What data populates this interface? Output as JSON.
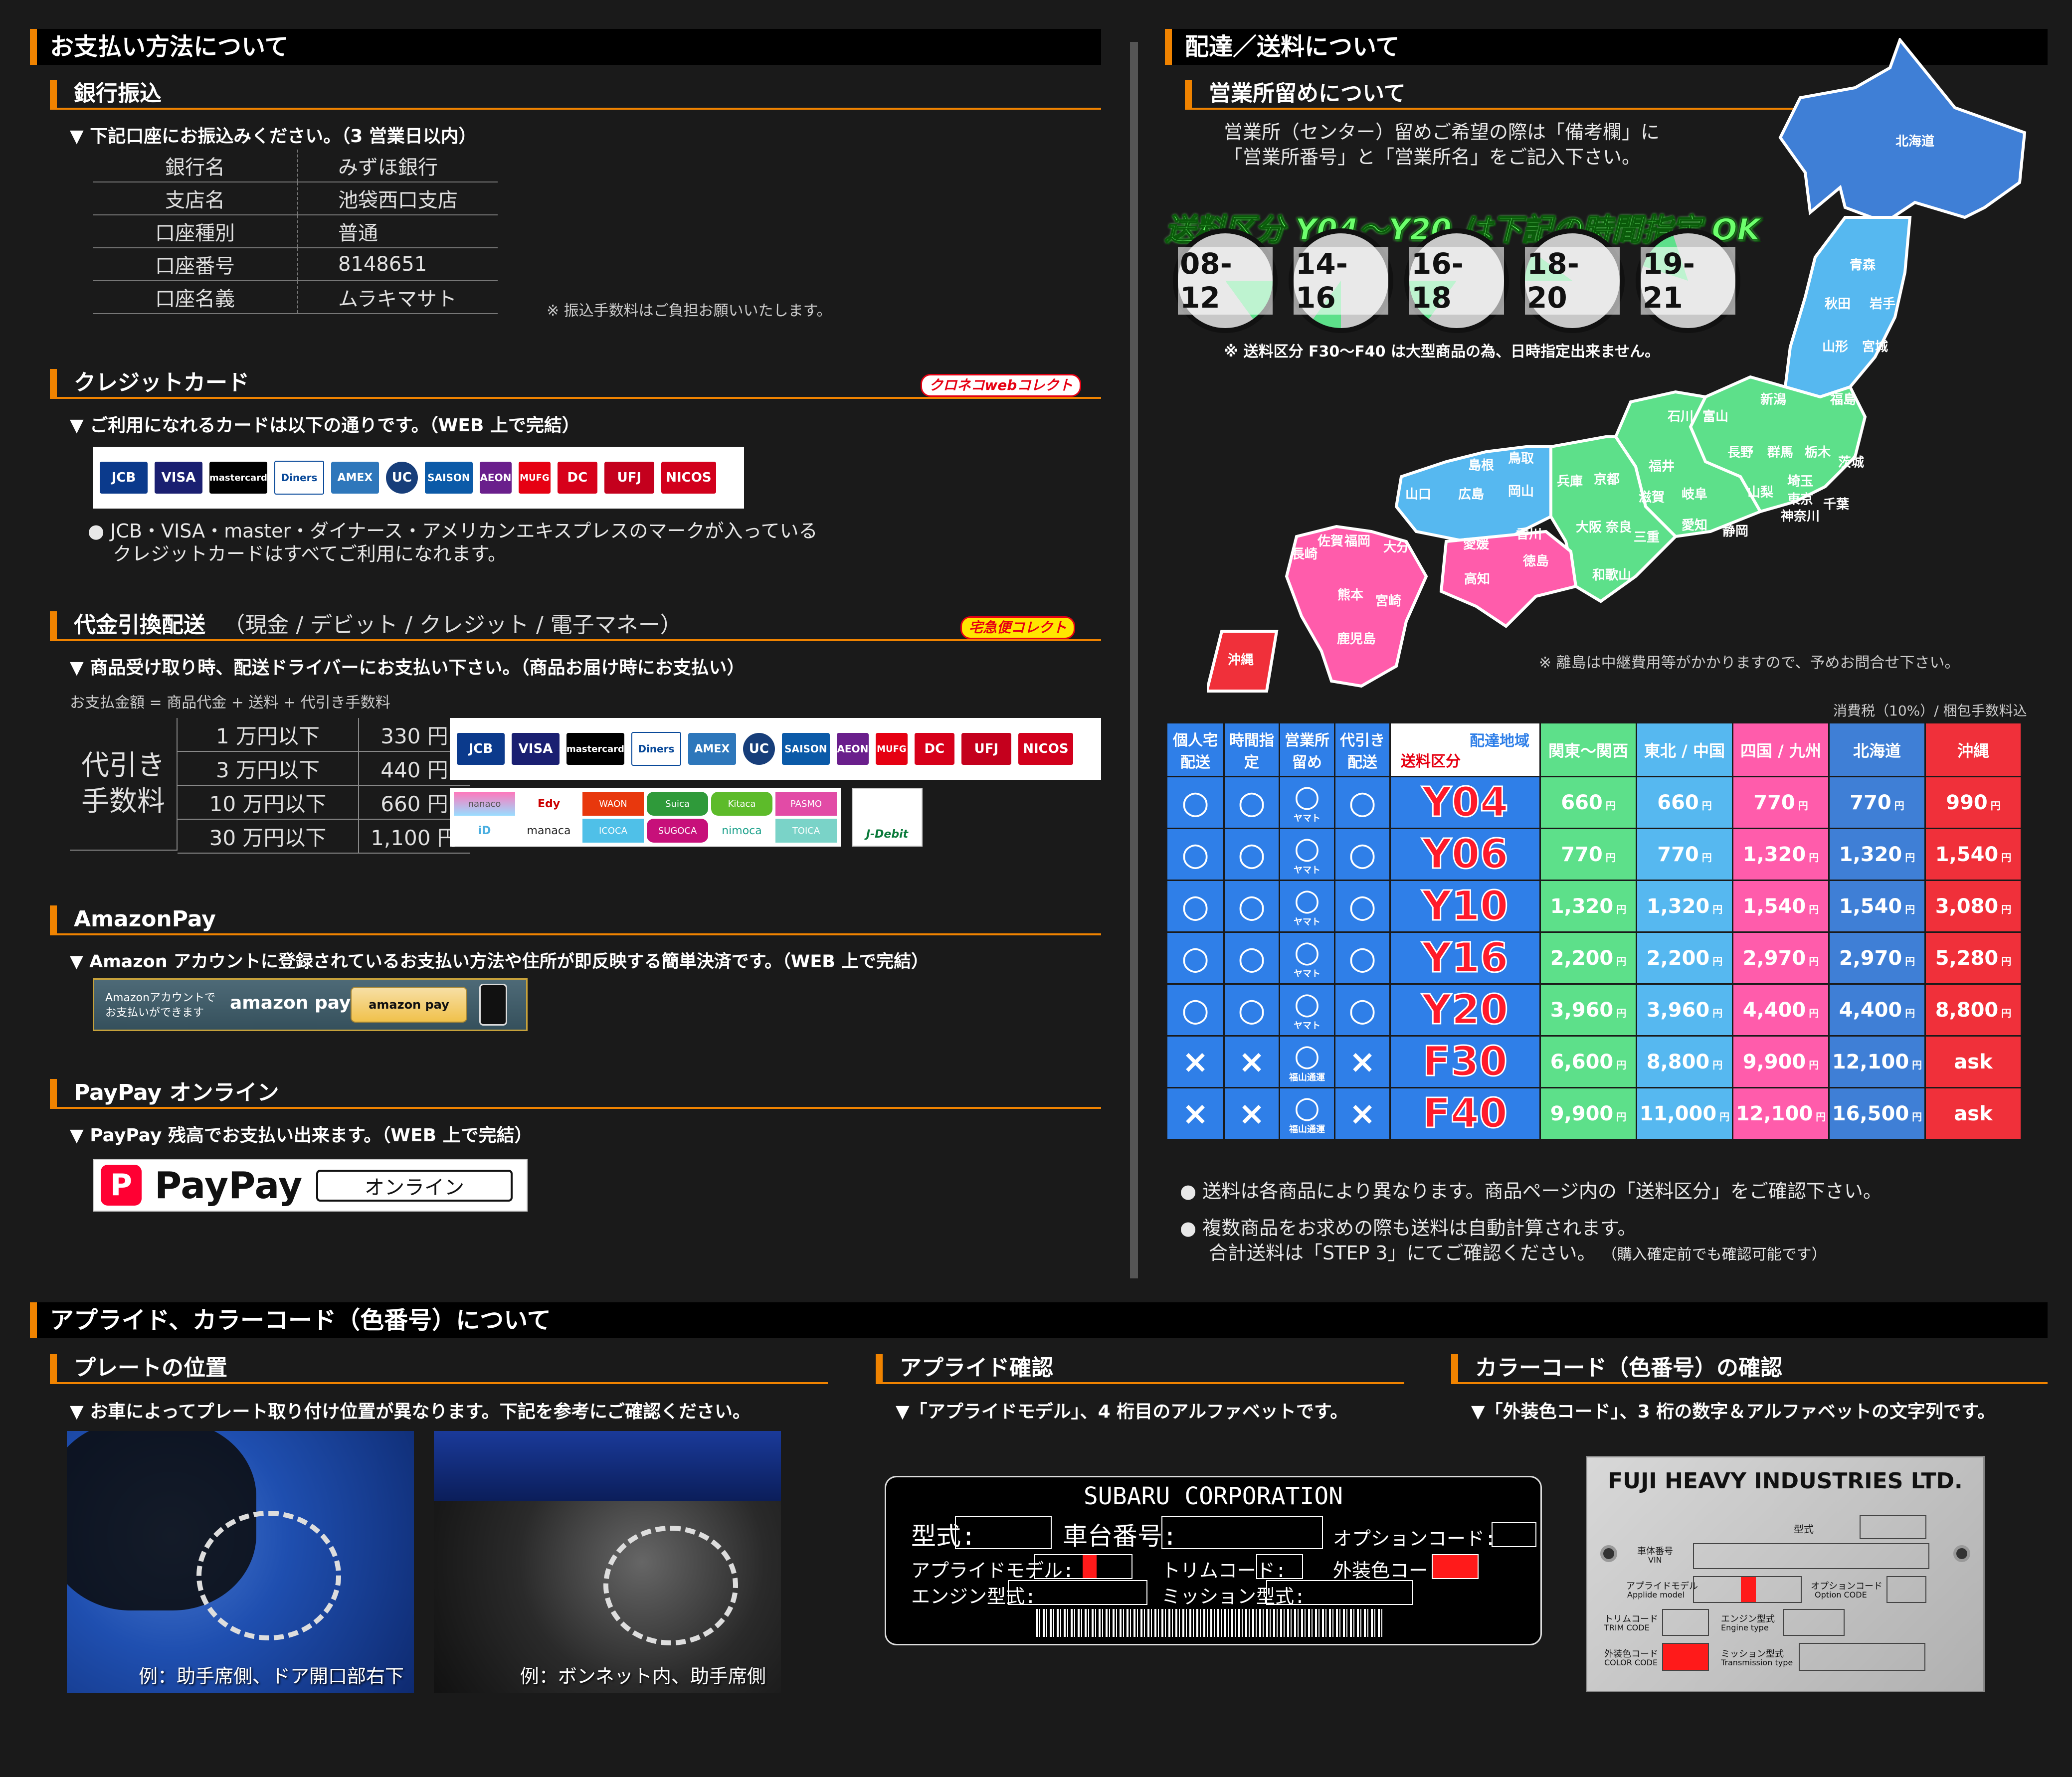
{
  "payment": {
    "title": "お支払い方法について",
    "bank": {
      "title": "銀行振込",
      "note": "▼ 下記口座にお振込みください。（3 営業日以内）",
      "rows": [
        {
          "k": "銀行名",
          "v": "みずほ銀行"
        },
        {
          "k": "支店名",
          "v": "池袋西口支店"
        },
        {
          "k": "口座種別",
          "v": "普通"
        },
        {
          "k": "口座番号",
          "v": "8148651"
        },
        {
          "k": "口座名義",
          "v": "ムラキマサト"
        }
      ],
      "fee_note": "※ 振込手数料はご負担お願いいたします。"
    },
    "credit": {
      "title": "クレジットカード",
      "badge": "クロネコwebコレクト",
      "note": "▼ ご利用になれるカードは以下の通りです。（WEB 上で完結）",
      "logos": [
        "JCB",
        "VISA",
        "mastercard",
        "Diners",
        "AMEX",
        "UC",
        "SAISON",
        "AEON",
        "MUFG",
        "DC",
        "UFJ",
        "NICOS"
      ],
      "bullet_line1": "● JCB・VISA・master・ダイナース・アメリカンエキスプレスのマークが入っている",
      "bullet_line2": "クレジットカードはすべてご利用になれます。"
    },
    "cod": {
      "title": "代金引換配送",
      "title_sub": "（現金 / デビット / クレジット / 電子マネー）",
      "badge": "宅急便コレクト",
      "note": "▼ 商品受け取り時、配送ドライバーにお支払い下さい。（商品お届け時にお支払い）",
      "formula": "お支払金額 = 商品代金 + 送料 + 代引き手数料",
      "fee_label_1": "代引き",
      "fee_label_2": "手数料",
      "fees": [
        {
          "range": "1 万円以下",
          "fee": "330 円"
        },
        {
          "range": "3 万円以下",
          "fee": "440 円"
        },
        {
          "range": "10 万円以下",
          "fee": "660 円"
        },
        {
          "range": "30 万円以下",
          "fee": "1,100 円"
        }
      ],
      "emoney": [
        "nanaco",
        "Edy",
        "WAON",
        "Suica",
        "Kitaca",
        "PASMO",
        "iD",
        "manaca",
        "ICOCA",
        "SUGOCA",
        "nimoca",
        "TOICA"
      ],
      "jdebit": "J-Debit"
    },
    "amazon": {
      "title": "AmazonPay",
      "note": "▼ Amazon アカウントに登録されているお支払い方法や住所が即反映する簡単決済です。（WEB 上で完結）",
      "banner_line1": "Amazonアカウントで",
      "banner_line2": "お支払いができます",
      "banner_brand": "amazon pay",
      "banner_button": "amazon pay"
    },
    "paypay": {
      "title": "PayPay オンライン",
      "note": "▼ PayPay 残高でお支払い出来ます。（WEB 上で完結）",
      "brand": "PayPay",
      "online": "オンライン"
    }
  },
  "delivery": {
    "title": "配達／送料について",
    "office": {
      "title": "営業所留めについて",
      "line1": "営業所（センター）留めご希望の際は「備考欄」に",
      "line2": "「営業所番号」と「営業所名」をご記入下さい。"
    },
    "time_headline": "送料区分 Y04〜Y20 は下記の時間指定 OK",
    "time_slots": [
      "08-12",
      "14-16",
      "16-18",
      "18-20",
      "19-21"
    ],
    "time_note": "※ 送料区分 F30〜F40 は大型商品の為、日時指定出来ません。",
    "island_note": "※ 離島は中継費用等がかかりますので、予めお問合せ下さい。",
    "tax_note": "消費税（10%）/ 梱包手数料込",
    "regions": {
      "hokkaido": "北海道",
      "aomori": "青森",
      "akita": "秋田",
      "iwate": "岩手",
      "yamagata": "山形",
      "miyagi": "宮城",
      "niigata": "新潟",
      "fukushima": "福島",
      "ishikawa": "石川",
      "toyama": "富山",
      "nagano": "長野",
      "gunma": "群馬",
      "tochigi": "栃木",
      "ibaraki": "茨城",
      "yamanashi": "山梨",
      "saitama": "埼玉",
      "tokyo": "東京",
      "chiba": "千葉",
      "kanagawa": "神奈川",
      "fukui": "福井",
      "gifu": "岐阜",
      "shizuoka": "静岡",
      "aichi": "愛知",
      "shiga": "滋賀",
      "kyoto": "京都",
      "mie": "三重",
      "nara": "奈良",
      "osaka": "大阪",
      "hyogo": "兵庫",
      "wakayama": "和歌山",
      "tottori": "鳥取",
      "shimane": "島根",
      "okayama": "岡山",
      "hiroshima": "広島",
      "yamaguchi": "山口",
      "kagawa": "香川",
      "tokushima": "徳島",
      "ehime": "愛媛",
      "kochi": "高知",
      "fukuoka": "福岡",
      "saga": "佐賀",
      "nagasaki": "長崎",
      "oita": "大分",
      "kumamoto": "熊本",
      "miyazaki": "宮崎",
      "kagoshima": "鹿児島",
      "okinawa": "沖縄"
    },
    "table": {
      "head_home": "個人宅配送",
      "head_time": "時間指定",
      "head_office": "営業所留め",
      "head_cod": "代引き配送",
      "head_area": "配達地域",
      "head_class": "送料区分",
      "regions": [
        "関東〜関西",
        "東北 / 中国",
        "四国 / 九州",
        "北海道",
        "沖縄"
      ],
      "rows": [
        {
          "code": "Y04",
          "home": "○",
          "time": "○",
          "office": "○",
          "office_sub": "ヤマト",
          "cod": "○",
          "prices": [
            "660",
            "660",
            "770",
            "770",
            "990"
          ]
        },
        {
          "code": "Y06",
          "home": "○",
          "time": "○",
          "office": "○",
          "office_sub": "ヤマト",
          "cod": "○",
          "prices": [
            "770",
            "770",
            "1,320",
            "1,320",
            "1,540"
          ]
        },
        {
          "code": "Y10",
          "home": "○",
          "time": "○",
          "office": "○",
          "office_sub": "ヤマト",
          "cod": "○",
          "prices": [
            "1,320",
            "1,320",
            "1,540",
            "1,540",
            "3,080"
          ]
        },
        {
          "code": "Y16",
          "home": "○",
          "time": "○",
          "office": "○",
          "office_sub": "ヤマト",
          "cod": "○",
          "prices": [
            "2,200",
            "2,200",
            "2,970",
            "2,970",
            "5,280"
          ]
        },
        {
          "code": "Y20",
          "home": "○",
          "time": "○",
          "office": "○",
          "office_sub": "ヤマト",
          "cod": "○",
          "prices": [
            "3,960",
            "3,960",
            "4,400",
            "4,400",
            "8,800"
          ]
        },
        {
          "code": "F30",
          "home": "×",
          "time": "×",
          "office": "○",
          "office_sub": "福山通運",
          "cod": "×",
          "prices": [
            "6,600",
            "8,800",
            "9,900",
            "12,100",
            "ask"
          ]
        },
        {
          "code": "F40",
          "home": "×",
          "time": "×",
          "office": "○",
          "office_sub": "福山通運",
          "cod": "×",
          "prices": [
            "9,900",
            "11,000",
            "12,100",
            "16,500",
            "ask"
          ]
        }
      ],
      "yen": "円"
    },
    "bullets": {
      "b1": "● 送料は各商品により異なります。商品ページ内の「送料区分」をご確認下さい。",
      "b2": "● 複数商品をお求めの際も送料は自動計算されます。",
      "b3": "合計送料は「STEP 3」にてご確認ください。",
      "b3_small": "（購入確定前でも確認可能です）"
    }
  },
  "applied": {
    "title": "アプライド、カラーコード（色番号）について",
    "plate_position": {
      "title": "プレートの位置",
      "note": "▼ お車によってプレート取り付け位置が異なります。下記を参考にご確認ください。",
      "photo1_caption": "例：助手席側、ドア開口部右下",
      "photo2_caption": "例：ボンネット内、助手席側"
    },
    "applied_check": {
      "title": "アプライド確認",
      "note": "▼「アプライドモデル」、4 桁目のアルファベットです。",
      "plate_title": "SUBARU CORPORATION",
      "l_model": "型式:",
      "l_chassis": "車台番号:",
      "l_option": "オプションコード:",
      "l_applied": "アプライドモデル:",
      "l_trim": "トリムコード:",
      "l_color": "外装色コード:",
      "l_engine": "エンジン型式:",
      "l_mission": "ミッション型式:"
    },
    "color_check": {
      "title": "カラーコード（色番号）の確認",
      "note": "▼「外装色コード」、3 桁の数字＆アルファベットの文字列です。",
      "plate_title": "FUJI HEAVY INDUSTRIES LTD.",
      "l_model": "型式",
      "l_vin": "車体番号",
      "l_vin_en": "VIN",
      "l_applied": "アプライドモデル",
      "l_applied_en": "Applide model",
      "l_option": "オプションコード",
      "l_option_en": "Option CODE",
      "l_trim": "トリムコード",
      "l_trim_en": "TRIM CODE",
      "l_engine": "エンジン型式",
      "l_engine_en": "Engine type",
      "l_color": "外装色コード",
      "l_color_en": "COLOR CODE",
      "l_mission": "ミッション型式",
      "l_mission_en": "Transmission type"
    }
  },
  "colors": {
    "accent": "#f08300",
    "kanto": "#5de08a",
    "tohoku": "#56b8f0",
    "shikoku": "#ff5cab",
    "hokkaido": "#3f7fd6",
    "okinawa": "#f0303a",
    "row_blue": "#2f7fe8"
  }
}
